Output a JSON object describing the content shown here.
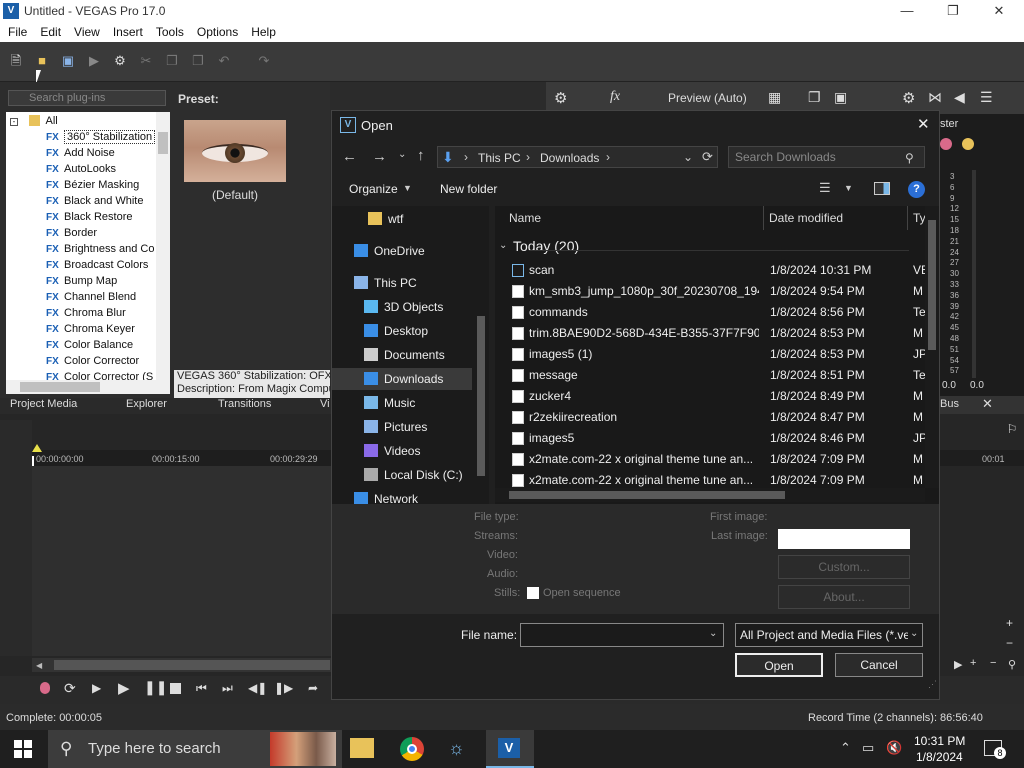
{
  "app": {
    "title": "Untitled - VEGAS Pro 17.0",
    "logo_text": "V",
    "menu": [
      "File",
      "Edit",
      "View",
      "Insert",
      "Tools",
      "Options",
      "Help"
    ]
  },
  "plugins": {
    "search_placeholder": "Search plug-ins",
    "root": "All",
    "items": [
      "360° Stabilization",
      "Add Noise",
      "AutoLooks",
      "Bézier Masking",
      "Black and White",
      "Black Restore",
      "Border",
      "Brightness and Co",
      "Broadcast Colors",
      "Bump Map",
      "Channel Blend",
      "Chroma Blur",
      "Chroma Keyer",
      "Color Balance",
      "Color Corrector",
      "Color Corrector (S"
    ],
    "fx_label": "FX",
    "preset_label": "Preset:",
    "preset_default": "(Default)",
    "desc_line1": "VEGAS 360° Stabilization: OFX,",
    "desc_line2": "Description: From Magix Compu",
    "tabs": [
      "Project Media",
      "Explorer",
      "Transitions",
      "Vi"
    ]
  },
  "preview": {
    "label": "Preview (Auto)"
  },
  "meter": {
    "label": "ster",
    "scale": [
      "3",
      "6",
      "9",
      "12",
      "15",
      "18",
      "21",
      "24",
      "27",
      "30",
      "33",
      "36",
      "39",
      "42",
      "45",
      "48",
      "51",
      "54",
      "57"
    ],
    "bottom": [
      "0.0",
      "0.0"
    ],
    "bus": "Bus"
  },
  "timeline": {
    "ruler": [
      "00:00:00:00",
      "00:00:15:00",
      "00:00:29:29"
    ],
    "ruler_right": "00:01"
  },
  "status": {
    "left": "Complete: 00:00:05",
    "right": "Record Time (2 channels): 86:56:40"
  },
  "taskbar": {
    "search_placeholder": "Type here to search",
    "time": "10:31 PM",
    "date": "1/8/2024",
    "notifications": "8"
  },
  "dialog": {
    "title": "Open",
    "address": [
      "This PC",
      "Downloads"
    ],
    "search_placeholder": "Search Downloads",
    "organize": "Organize",
    "new_folder": "New folder",
    "nav": [
      "wtf",
      "OneDrive",
      "This PC",
      "3D Objects",
      "Desktop",
      "Documents",
      "Downloads",
      "Music",
      "Pictures",
      "Videos",
      "Local Disk (C:)",
      "Network"
    ],
    "columns": {
      "name": "Name",
      "date": "Date modified",
      "type": "Ty"
    },
    "group": "Today (20)",
    "files": [
      {
        "name": "scan",
        "date": "1/8/2024 10:31 PM",
        "type": "VE"
      },
      {
        "name": "km_smb3_jump_1080p_30f_20230708_194...",
        "date": "1/8/2024 9:54 PM",
        "type": "M"
      },
      {
        "name": "commands",
        "date": "1/8/2024 8:56 PM",
        "type": "Te"
      },
      {
        "name": "trim.8BAE90D2-568D-434E-B355-37F7F90...",
        "date": "1/8/2024 8:53 PM",
        "type": "M"
      },
      {
        "name": "images5 (1)",
        "date": "1/8/2024 8:53 PM",
        "type": "JP"
      },
      {
        "name": "message",
        "date": "1/8/2024 8:51 PM",
        "type": "Te"
      },
      {
        "name": "zucker4",
        "date": "1/8/2024 8:49 PM",
        "type": "M"
      },
      {
        "name": "r2zekiirecreation",
        "date": "1/8/2024 8:47 PM",
        "type": "M"
      },
      {
        "name": "images5",
        "date": "1/8/2024 8:46 PM",
        "type": "JP"
      },
      {
        "name": "x2mate.com-22 x original theme tune an...",
        "date": "1/8/2024 7:09 PM",
        "type": "M"
      },
      {
        "name": "x2mate.com-22 x original theme tune an...",
        "date": "1/8/2024 7:09 PM",
        "type": "M"
      }
    ],
    "info_labels": {
      "file_type": "File type:",
      "streams": "Streams:",
      "video": "Video:",
      "audio": "Audio:",
      "stills": "Stills:",
      "first_image": "First image:",
      "last_image": "Last image:"
    },
    "open_sequence": "Open sequence",
    "custom": "Custom...",
    "about": "About...",
    "file_name_label": "File name:",
    "file_name_value": "",
    "filter": "All Project and Media Files (*.ve",
    "open": "Open",
    "cancel": "Cancel"
  }
}
